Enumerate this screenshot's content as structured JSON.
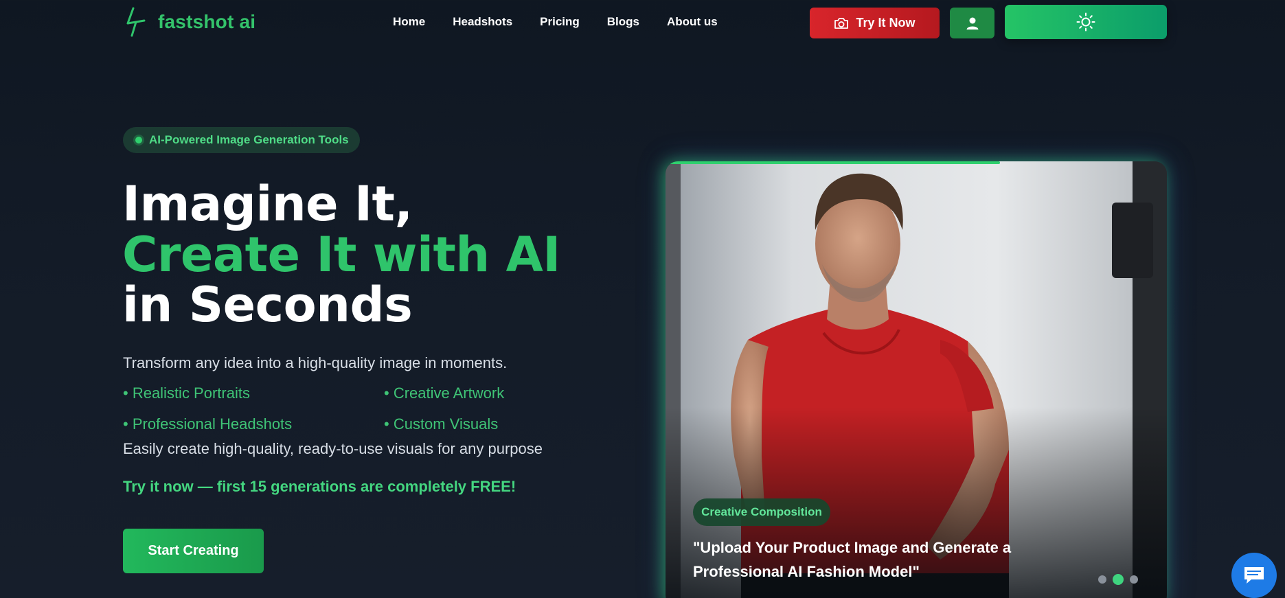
{
  "brand": {
    "name": "fastshot ai",
    "color": "#34c36b"
  },
  "nav": {
    "items": [
      {
        "label": "Home"
      },
      {
        "label": "Headshots"
      },
      {
        "label": "Pricing"
      },
      {
        "label": "Blogs"
      },
      {
        "label": "About us"
      }
    ],
    "try_label": "Try It Now",
    "icons": {
      "try": "camera-icon",
      "user": "user-icon",
      "theme": "sun-icon"
    }
  },
  "hero": {
    "badge": "AI-Powered Image Generation Tools",
    "title_line1": "Imagine It,",
    "title_line2": "Create It with AI",
    "title_line3": "in Seconds",
    "lead": "Transform any idea into a high-quality image in moments.",
    "features": [
      "• Realistic Portraits",
      "• Creative Artwork",
      "• Professional Headshots",
      "• Custom Visuals"
    ],
    "subtext": "Easily create high-quality, ready-to-use visuals for any purpose",
    "promo": "Try it now — first 15 generations are completely FREE!",
    "cta_label": "Start Creating"
  },
  "showcase": {
    "tag": "Creative Composition",
    "caption": "\"Upload Your Product Image and Generate a Professional AI Fashion Model\"",
    "progress": 0.667,
    "slides": 3,
    "active_slide": 2
  },
  "chat": {
    "icon": "chat-icon"
  },
  "colors": {
    "accent": "#2fc46b",
    "danger": "#d8252b",
    "background": "#131b27"
  }
}
